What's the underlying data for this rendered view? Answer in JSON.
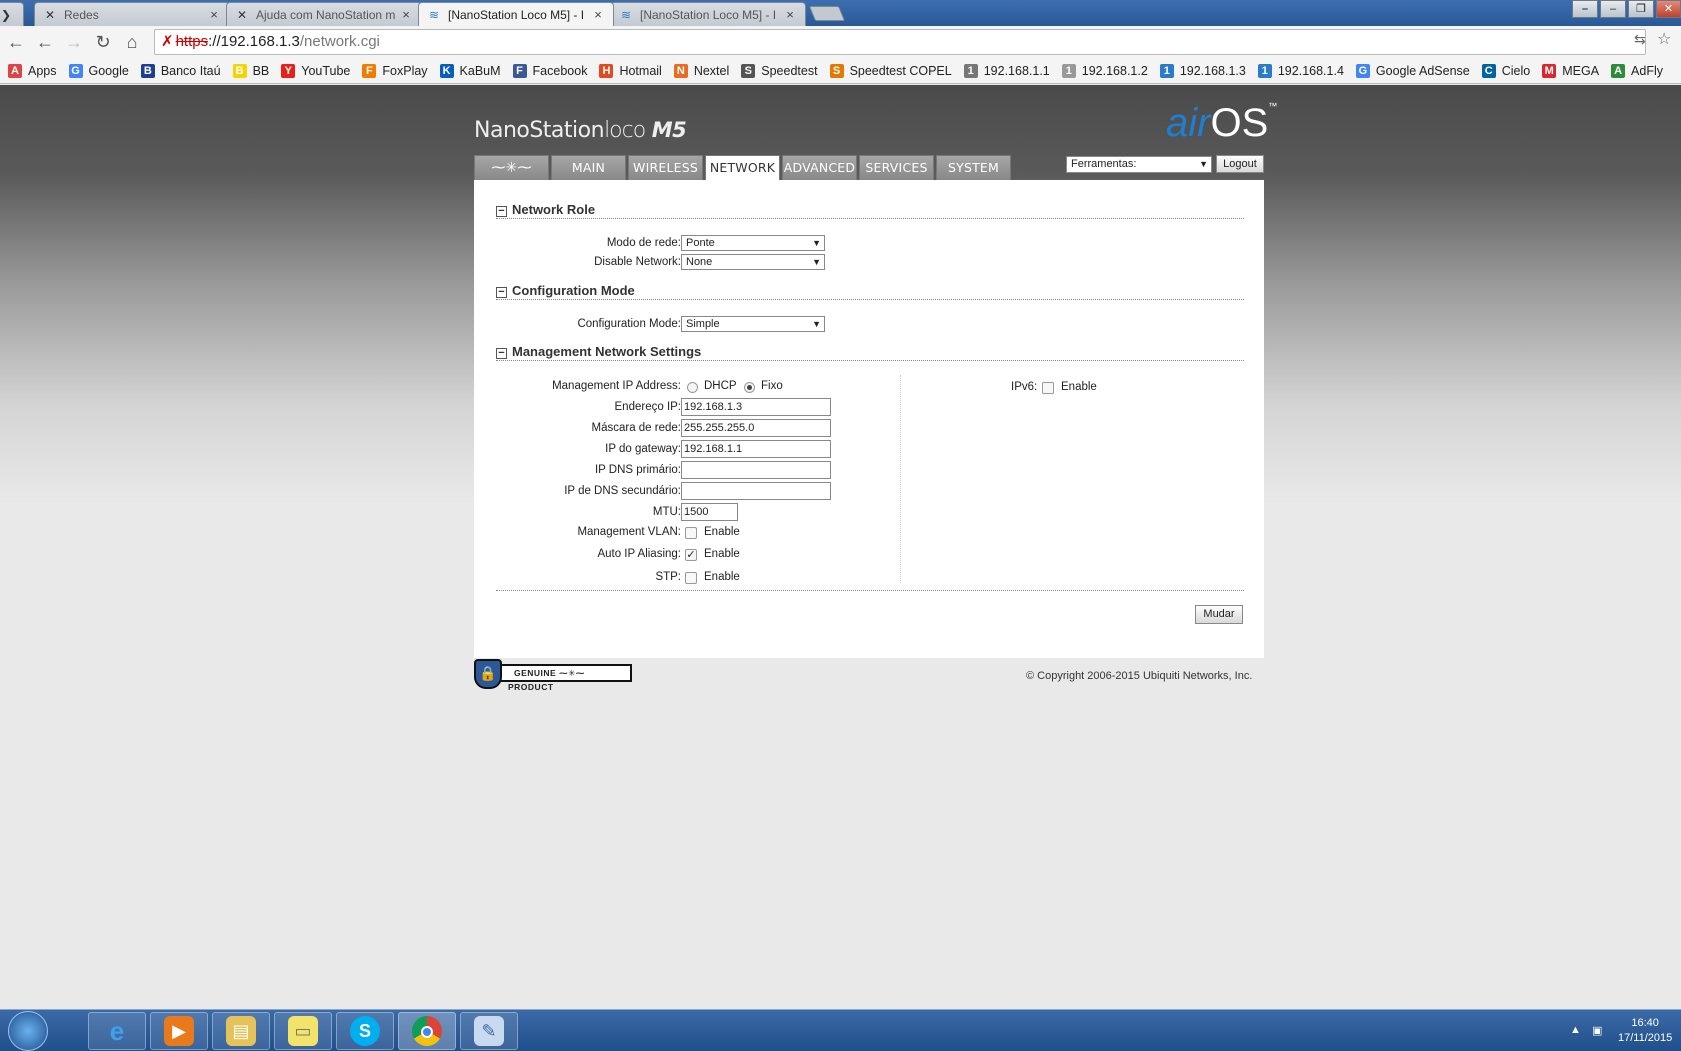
{
  "browser": {
    "tabs": [
      {
        "title": "Redes",
        "icon": "favicon-redes"
      },
      {
        "title": "Ajuda com NanoStation m",
        "icon": "favicon-forum"
      },
      {
        "title": "[NanoStation Loco M5] - I",
        "icon": "favicon-wifi",
        "active": true
      },
      {
        "title": "[NanoStation Loco M5] - I",
        "icon": "favicon-wifi"
      }
    ],
    "url": {
      "protocol": "https",
      "host": "://192.168.1.3",
      "path": "/network.cgi"
    },
    "bookmarks": [
      {
        "label": "Apps",
        "icon": "apps-grid-icon",
        "color": "#d44"
      },
      {
        "label": "Google",
        "icon": "google-icon",
        "color": "#4285f4"
      },
      {
        "label": "Banco Itaú",
        "icon": "itau-icon",
        "color": "#1c3f94"
      },
      {
        "label": "BB",
        "icon": "bb-icon",
        "color": "#f5d400"
      },
      {
        "label": "YouTube",
        "icon": "youtube-icon",
        "color": "#e62117"
      },
      {
        "label": "FoxPlay",
        "icon": "foxplay-icon",
        "color": "#f07d00"
      },
      {
        "label": "KaBuM",
        "icon": "kabum-icon",
        "color": "#0a5db8"
      },
      {
        "label": "Facebook",
        "icon": "facebook-icon",
        "color": "#3b5998"
      },
      {
        "label": "Hotmail",
        "icon": "windows-icon",
        "color": "#e24a21"
      },
      {
        "label": "Nextel",
        "icon": "nextel-icon",
        "color": "#ea6b20"
      },
      {
        "label": "Speedtest",
        "icon": "speedtest-icon",
        "color": "#555"
      },
      {
        "label": "Speedtest COPEL",
        "icon": "copel-icon",
        "color": "#e07b00"
      },
      {
        "label": "192.168.1.1",
        "icon": "router-icon",
        "color": "#777"
      },
      {
        "label": "192.168.1.2",
        "icon": "page-icon",
        "color": "#999"
      },
      {
        "label": "192.168.1.3",
        "icon": "wifi-icon",
        "color": "#2a7bc9"
      },
      {
        "label": "192.168.1.4",
        "icon": "wifi-icon",
        "color": "#2a7bc9"
      },
      {
        "label": "Google AdSense",
        "icon": "google-icon",
        "color": "#4285f4"
      },
      {
        "label": "Cielo",
        "icon": "cielo-icon",
        "color": "#0064a0"
      },
      {
        "label": "MEGA",
        "icon": "mega-icon",
        "color": "#d9272e"
      },
      {
        "label": "AdFly",
        "icon": "adfly-icon",
        "color": "#2d8c3c"
      }
    ]
  },
  "airos": {
    "brand_name": "NanoStation",
    "brand_loco": "loco",
    "brand_model": "M5",
    "logo_air": "air",
    "logo_os": "OS",
    "logo_tm": "™",
    "nav": [
      "MAIN",
      "WIRELESS",
      "NETWORK",
      "ADVANCED",
      "SERVICES",
      "SYSTEM"
    ],
    "active_tab": "NETWORK",
    "tools_select": "Ferramentas:",
    "logout": "Logout",
    "sections": {
      "network_role": "Network Role",
      "configuration_mode": "Configuration Mode",
      "management": "Management Network Settings"
    },
    "fields": {
      "network_mode_label": "Modo de rede:",
      "network_mode_value": "Ponte",
      "disable_network_label": "Disable Network:",
      "disable_network_value": "None",
      "config_mode_label": "Configuration Mode:",
      "config_mode_value": "Simple",
      "mgmt_ip_label": "Management IP Address:",
      "dhcp_label": "DHCP",
      "fixo_label": "Fixo",
      "ip_label": "Endereço IP:",
      "ip_value": "192.168.1.3",
      "mask_label": "Máscara de rede:",
      "mask_value": "255.255.255.0",
      "gateway_label": "IP do gateway:",
      "gateway_value": "192.168.1.1",
      "dns1_label": "IP DNS primário:",
      "dns1_value": "",
      "dns2_label": "IP de DNS secundário:",
      "dns2_value": "",
      "mtu_label": "MTU:",
      "mtu_value": "1500",
      "vlan_label": "Management VLAN:",
      "auto_ip_label": "Auto IP Aliasing:",
      "stp_label": "STP:",
      "ipv6_label": "IPv6:",
      "enable_label": "Enable"
    },
    "state": {
      "mgmt_ip_mode": "Fixo",
      "management_vlan": false,
      "auto_ip_aliasing": true,
      "stp": false,
      "ipv6": false
    },
    "submit": "Mudar",
    "genuine": "GENUINE",
    "product": "PRODUCT",
    "copyright": "© Copyright 2006-2015 Ubiquiti Networks, Inc."
  },
  "taskbar": {
    "time": "16:40",
    "date": "17/11/2015",
    "apps": [
      "internet-explorer-icon",
      "media-player-icon",
      "explorer-icon",
      "notes-icon",
      "skype-icon",
      "chrome-icon",
      "paint-icon"
    ]
  }
}
